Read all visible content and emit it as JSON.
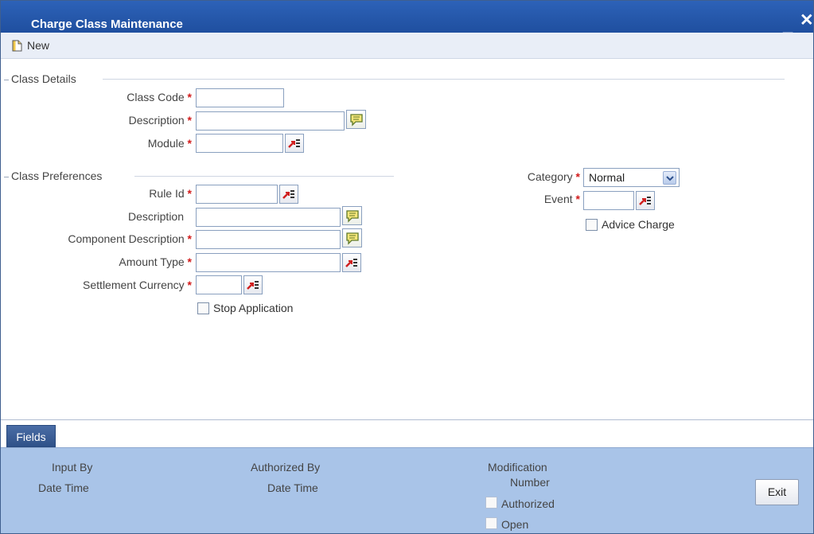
{
  "window": {
    "title": "Charge Class Maintenance",
    "minimize": "_",
    "close": "✕"
  },
  "toolbar": {
    "new_label": "New"
  },
  "class_details": {
    "title": "Class Details",
    "class_code_label": "Class Code",
    "description_label": "Description",
    "module_label": "Module"
  },
  "class_preferences": {
    "title": "Class Preferences",
    "rule_id_label": "Rule Id",
    "description_label": "Description",
    "component_description_label": "Component Description",
    "amount_type_label": "Amount Type",
    "settlement_currency_label": "Settlement Currency",
    "stop_application_label": "Stop Application"
  },
  "right_panel": {
    "category_label": "Category",
    "category_value": "Normal",
    "event_label": "Event",
    "advice_charge_label": "Advice Charge"
  },
  "required_mark": "*",
  "fields_button": "Fields",
  "footer": {
    "input_by": "Input By",
    "date_time_1": "Date Time",
    "authorized_by": "Authorized By",
    "date_time_2": "Date Time",
    "modification": "Modification",
    "number": "Number",
    "authorized": "Authorized",
    "open": "Open",
    "exit": "Exit"
  },
  "colors": {
    "titlebar": "#2d62b8",
    "footer": "#a9c4e8",
    "required": "#d21b1b",
    "fields_button": "#3a5d96"
  }
}
